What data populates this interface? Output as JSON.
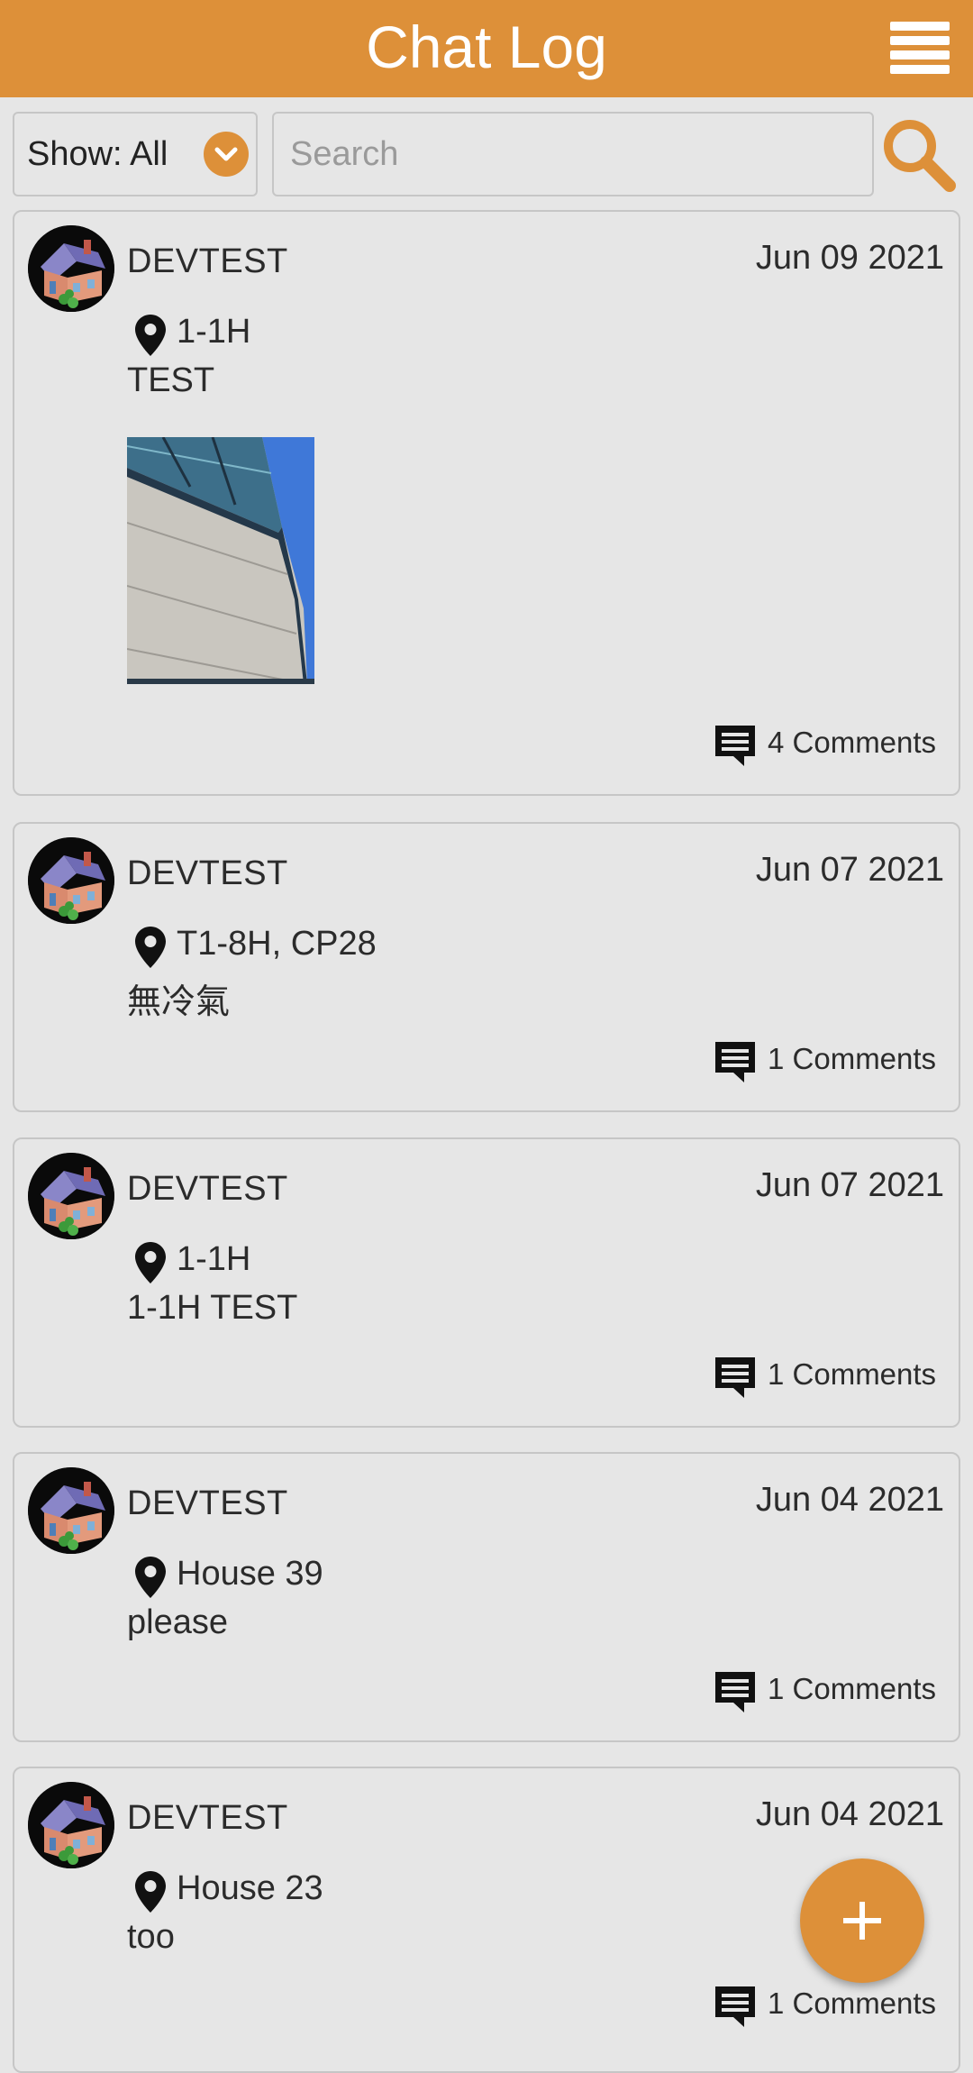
{
  "header": {
    "title": "Chat Log",
    "menu_icon": "hamburger-menu-icon"
  },
  "filter": {
    "label": "Show: All",
    "icon": "chevron-down-icon"
  },
  "search": {
    "placeholder": "Search",
    "icon": "search-icon"
  },
  "colors": {
    "accent": "#dd9039",
    "background": "#e6e6e6",
    "border": "#c6c6c6"
  },
  "posts": [
    {
      "user": "DEVTEST",
      "date": "Jun 09 2021",
      "location": "1-1H",
      "message": "TEST",
      "has_photo": true,
      "comments": "4 Comments"
    },
    {
      "user": "DEVTEST",
      "date": "Jun 07 2021",
      "location": "T1-8H, CP28",
      "message": "無冷氣",
      "has_photo": false,
      "comments": "1 Comments"
    },
    {
      "user": "DEVTEST",
      "date": "Jun 07 2021",
      "location": "1-1H",
      "message": "1-1H TEST",
      "has_photo": false,
      "comments": "1 Comments"
    },
    {
      "user": "DEVTEST",
      "date": "Jun 04 2021",
      "location": "House 39",
      "message": "please",
      "has_photo": false,
      "comments": "1 Comments"
    },
    {
      "user": "DEVTEST",
      "date": "Jun 04 2021",
      "location": "House 23",
      "message": "too",
      "has_photo": false,
      "comments": "1 Comments"
    }
  ],
  "fab": {
    "icon": "plus-icon"
  }
}
